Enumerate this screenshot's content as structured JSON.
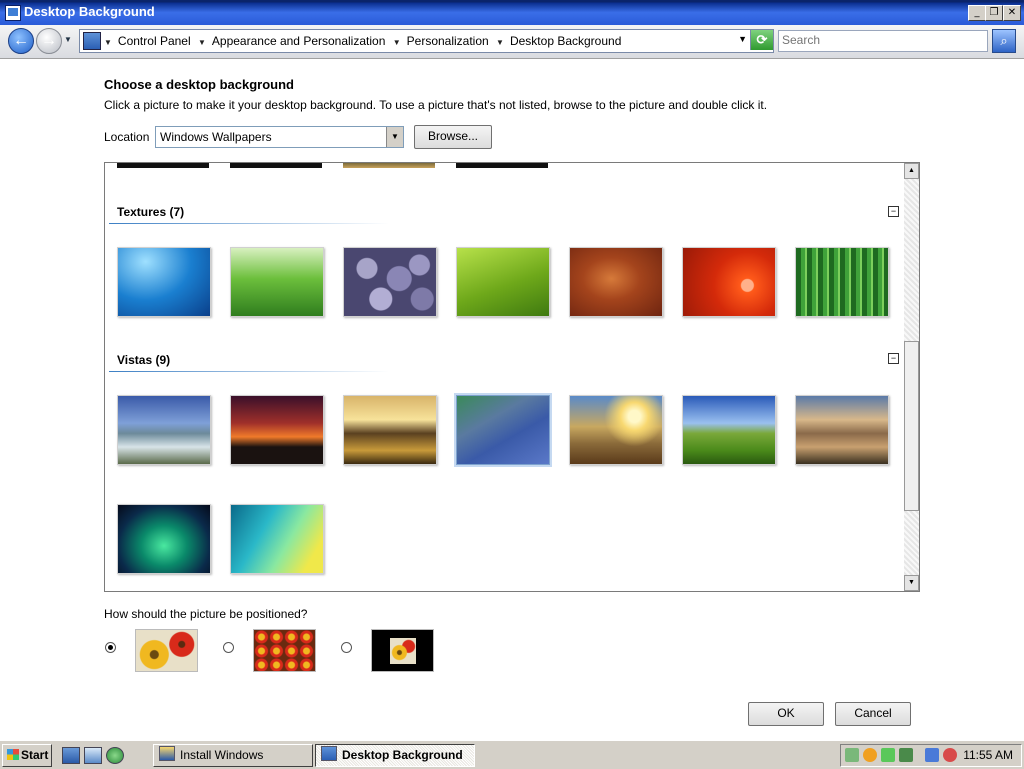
{
  "window": {
    "title": "Desktop Background"
  },
  "address": {
    "crumbs": [
      "Control Panel",
      "Appearance and Personalization",
      "Personalization",
      "Desktop Background"
    ],
    "search_placeholder": "Search"
  },
  "page": {
    "heading": "Choose a desktop background",
    "description": "Click a picture to make it your desktop background. To use a picture that's not listed, browse to the picture and double click it.",
    "location_label": "Location",
    "location_value": "Windows Wallpapers",
    "browse_label": "Browse..."
  },
  "groups": [
    {
      "title": "Textures (7)",
      "collapse_glyph": "−",
      "items": [
        "underwater-fish",
        "green-grass",
        "purple-stones",
        "green-leaf",
        "wood-texture",
        "red-flower",
        "green-bamboo"
      ]
    },
    {
      "title": "Vistas (9)",
      "collapse_glyph": "−",
      "items": [
        "mountain-lake",
        "dusk-silhouette",
        "rocky-shore",
        "palm-frond",
        "wheat-field-sunset",
        "green-hills",
        "canyon-reflection",
        "aurora",
        "vista-aero"
      ],
      "selected_index": 3
    }
  ],
  "position": {
    "label": "How should the picture be positioned?",
    "options": [
      "fit-to-screen",
      "tile",
      "center"
    ],
    "selected": 0
  },
  "buttons": {
    "ok": "OK",
    "cancel": "Cancel"
  },
  "taskbar": {
    "start": "Start",
    "tasks": [
      {
        "label": "Install Windows",
        "active": false
      },
      {
        "label": "Desktop Background",
        "active": true
      }
    ],
    "clock": "11:55 AM"
  },
  "colors": {
    "titlebar": "#2a5bd8",
    "selection": "#c5d9f1",
    "taskbar": "#d4d0c8"
  }
}
